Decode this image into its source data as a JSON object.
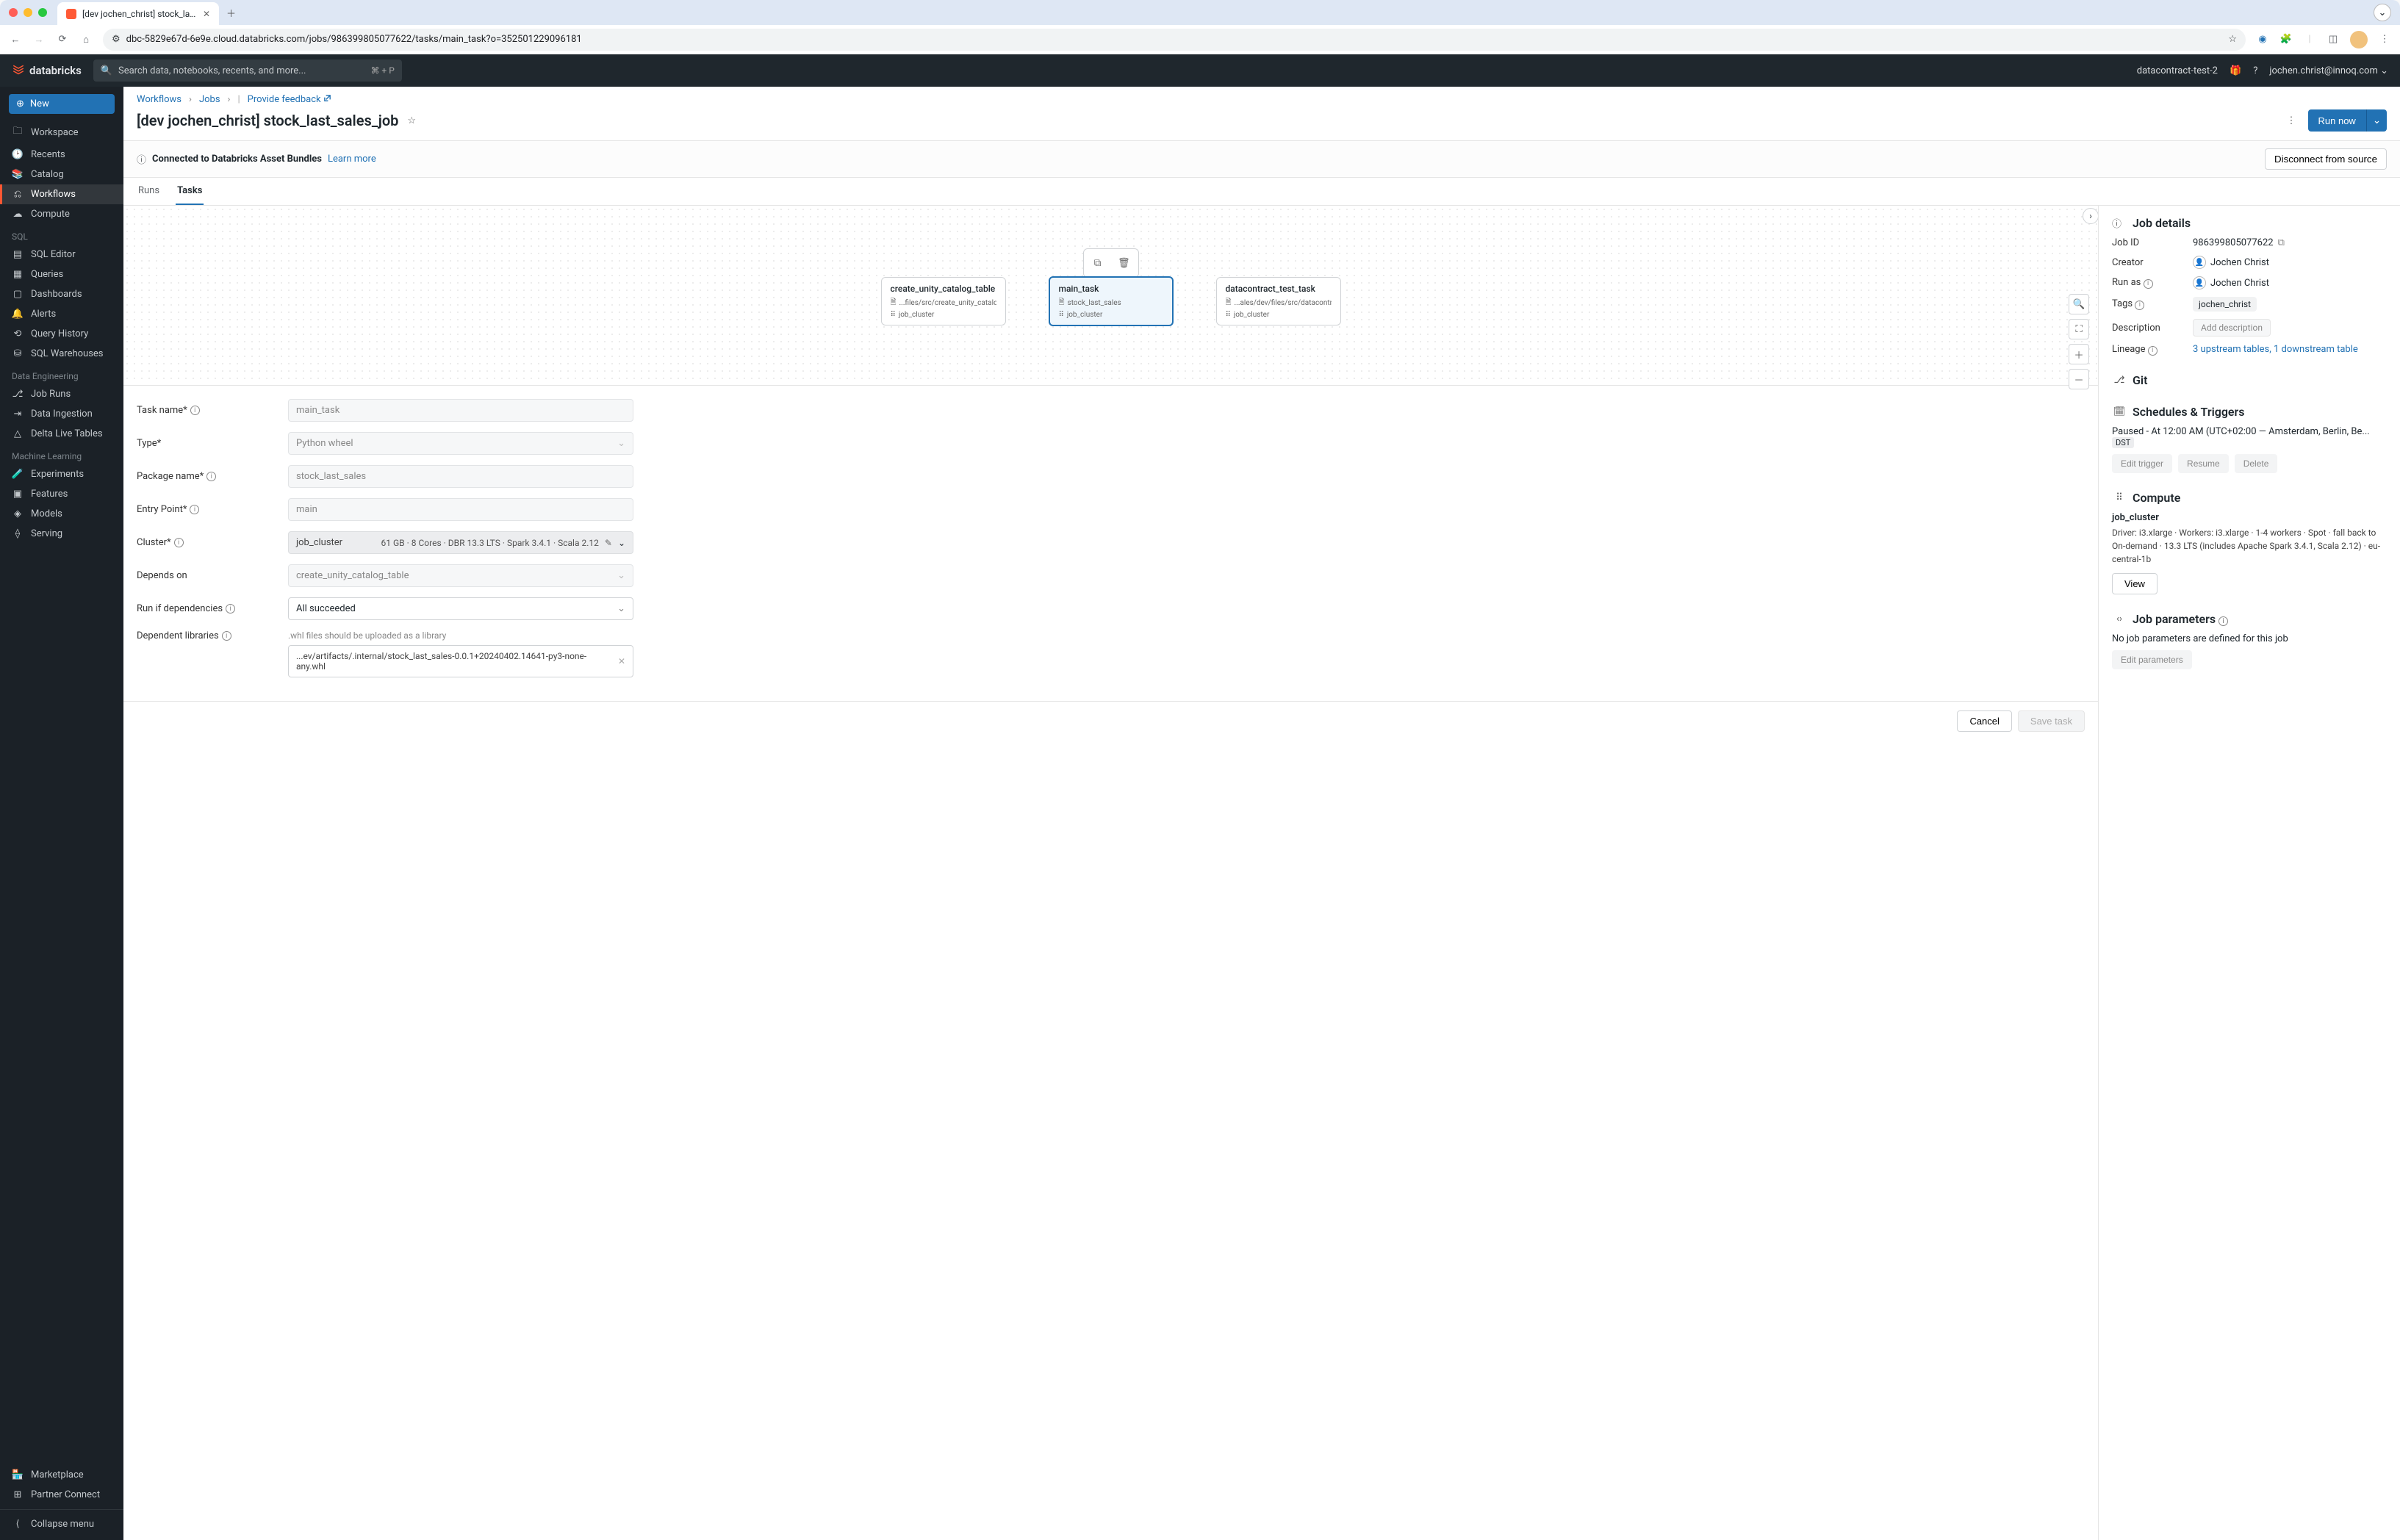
{
  "browser": {
    "tab_title": "[dev jochen_christ] stock_las...",
    "url": "dbc-5829e67d-6e9e.cloud.databricks.com/jobs/986399805077622/tasks/main_task?o=352501229096181"
  },
  "topbar": {
    "brand": "databricks",
    "search_placeholder": "Search data, notebooks, recents, and more...",
    "search_kbd": "⌘ + P",
    "workspace": "datacontract-test-2",
    "user_email": "jochen.christ@innoq.com"
  },
  "sidebar": {
    "new_label": "New",
    "items_main": [
      "Workspace",
      "Recents",
      "Catalog",
      "Workflows",
      "Compute"
    ],
    "section_sql": "SQL",
    "items_sql": [
      "SQL Editor",
      "Queries",
      "Dashboards",
      "Alerts",
      "Query History",
      "SQL Warehouses"
    ],
    "section_de": "Data Engineering",
    "items_de": [
      "Job Runs",
      "Data Ingestion",
      "Delta Live Tables"
    ],
    "section_ml": "Machine Learning",
    "items_ml": [
      "Experiments",
      "Features",
      "Models",
      "Serving"
    ],
    "items_bottom": [
      "Marketplace",
      "Partner Connect",
      "Collapse menu"
    ]
  },
  "breadcrumb": {
    "item1": "Workflows",
    "item2": "Jobs",
    "feedback": "Provide feedback"
  },
  "page_title": "[dev jochen_christ] stock_last_sales_job",
  "run_now": "Run now",
  "banner": {
    "text": "Connected to Databricks Asset Bundles",
    "link": "Learn more",
    "disconnect": "Disconnect from source"
  },
  "tabs": {
    "runs": "Runs",
    "tasks": "Tasks"
  },
  "dag": {
    "nodes": [
      {
        "title": "create_unity_catalog_table",
        "meta1": "...files/src/create_unity_catalog_table",
        "meta2": "job_cluster"
      },
      {
        "title": "main_task",
        "meta1": "stock_last_sales",
        "meta2": "job_cluster"
      },
      {
        "title": "datacontract_test_task",
        "meta1": "...ales/dev/files/src/datacontract_test",
        "meta2": "job_cluster"
      }
    ]
  },
  "form": {
    "task_name_label": "Task name*",
    "task_name_value": "main_task",
    "type_label": "Type*",
    "type_value": "Python wheel",
    "package_label": "Package name*",
    "package_value": "stock_last_sales",
    "entry_label": "Entry Point*",
    "entry_value": "main",
    "cluster_label": "Cluster*",
    "cluster_name": "job_cluster",
    "cluster_spec": "61 GB · 8 Cores · DBR 13.3 LTS · Spark 3.4.1 · Scala 2.12",
    "depends_label": "Depends on",
    "depends_value": "create_unity_catalog_table",
    "runif_label": "Run if dependencies",
    "runif_value": "All succeeded",
    "libs_label": "Dependent libraries",
    "libs_hint": ".whl files should be uploaded as a library",
    "libs_value": "...ev/artifacts/.internal/stock_last_sales-0.0.1+20240402.14641-py3-none-any.whl"
  },
  "footer": {
    "cancel": "Cancel",
    "save": "Save task"
  },
  "details": {
    "heading": "Job details",
    "job_id_k": "Job ID",
    "job_id_v": "986399805077622",
    "creator_k": "Creator",
    "creator_v": "Jochen Christ",
    "runas_k": "Run as",
    "runas_v": "Jochen Christ",
    "tags_k": "Tags",
    "tags_v": "jochen_christ",
    "desc_k": "Description",
    "desc_placeholder": "Add description",
    "lineage_k": "Lineage",
    "lineage_v": "3 upstream tables, 1 downstream table",
    "git_heading": "Git",
    "sched_heading": "Schedules & Triggers",
    "sched_text": "Paused - At 12:00 AM (UTC+02:00 — Amsterdam, Berlin, Be...",
    "sched_badge": "DST",
    "sched_edit": "Edit trigger",
    "sched_resume": "Resume",
    "sched_delete": "Delete",
    "compute_heading": "Compute",
    "compute_name": "job_cluster",
    "compute_desc": "Driver: i3.xlarge · Workers: i3.xlarge · 1-4 workers · Spot · fall back to On-demand · 13.3 LTS (includes Apache Spark 3.4.1, Scala 2.12) · eu-central-1b",
    "compute_view": "View",
    "params_heading": "Job parameters",
    "params_text": "No job parameters are defined for this job",
    "params_edit": "Edit parameters"
  }
}
